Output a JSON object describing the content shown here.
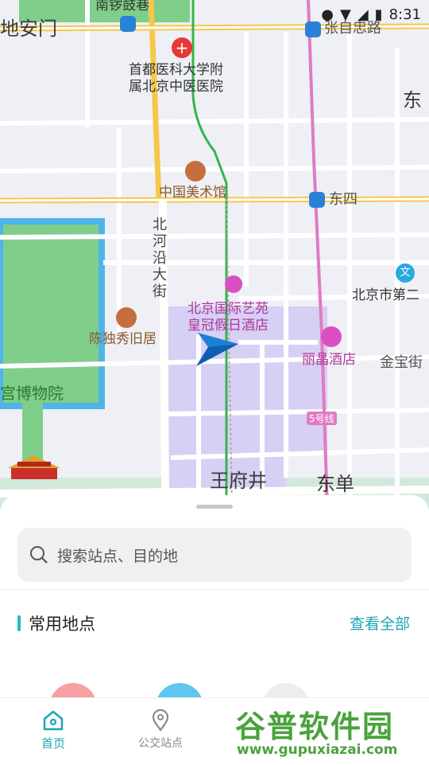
{
  "status_bar": {
    "time": "8:31"
  },
  "map": {
    "labels": {
      "nanluoguxiang": "南锣鼓巷",
      "dianmen": "地安门",
      "zhangzizhonglu": "张自忠路",
      "hospital_line1": "首都医科大学附",
      "hospital_line2": "属北京中医医院",
      "dong": "东",
      "art_museum": "中国美术馆",
      "dongsi": "东四",
      "beiheyan": "北河沿大街",
      "beijing_di_er": "北京市第二",
      "hotel_line1": "北京国际艺苑",
      "hotel_line2": "皇冠假日酒店",
      "chen_duxiu": "陈独秀旧居",
      "lijing": "丽晶酒店",
      "jinbao": "金宝街",
      "palace_museum": "宫博物院",
      "line5": "5号线",
      "wangfujing": "王府井",
      "dongdan": "东单"
    },
    "icons": [
      "hospital-icon",
      "museum-icon",
      "hotel-icon",
      "school-icon",
      "metro-icon",
      "navigation-arrow-icon",
      "tiananmen-icon"
    ]
  },
  "sheet": {
    "search_placeholder": "搜索站点、目的地",
    "section_title": "常用地点",
    "view_all": "查看全部"
  },
  "tabs": [
    {
      "label": "首页",
      "icon": "home-icon",
      "active": true
    },
    {
      "label": "公交站点",
      "icon": "bus-stop-pin-icon",
      "active": false
    }
  ],
  "watermark": {
    "title": "谷普软件园",
    "url": "www.gupuxiazai.com"
  },
  "colors": {
    "accent": "#27b8c9",
    "active_tab": "#1aa6b7",
    "map_green": "#7fce8a",
    "metro_pink": "#e07bc2",
    "hotel_magenta": "#d94fc0"
  }
}
